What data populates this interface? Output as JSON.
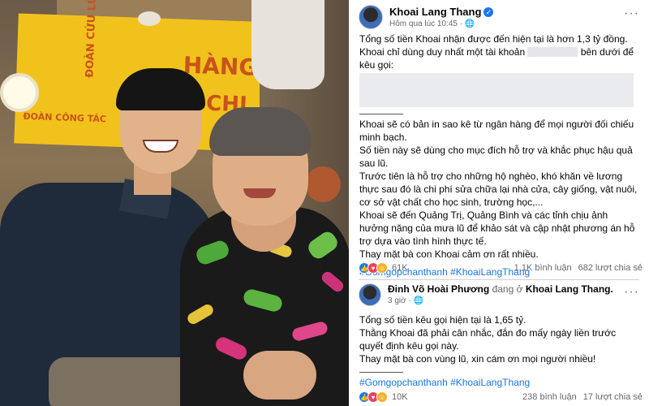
{
  "photo": {
    "banner_lines": [
      "ĐOÀN CỨU LŨ",
      "HÀNG",
      "CHI",
      "ĐOÀN CÔNG TÁC"
    ],
    "alt_icon": "photo-two-people"
  },
  "post": {
    "author": "Khoai Lang Thang",
    "verified_icon": "verified-badge-icon",
    "time": "Hôm qua lúc 10:45",
    "privacy_icon": "globe-icon",
    "menu_icon": "more-dots-icon",
    "paragraphs": [
      "Tổng số tiền Khoai nhận được đến hiện tại là hơn 1,3 tỷ đồng.",
      "Khoai sẽ có bản in sao kê từ ngân hàng để mọi người đối chiếu minh bạch.",
      "Số tiền này sẽ dùng cho mục đích hỗ trợ và khắc phục hậu quả sau lũ.",
      "Trước tiên là hỗ trợ cho những hộ nghèo, khó khăn về lương thực sau đó là chi phí sửa chữa lại nhà cửa, cây giống, vật nuôi, cơ sở vật chất cho học sinh, trường học,...",
      "Khoai sẽ đến Quảng Trị, Quảng Bình và các tỉnh chịu ảnh hưởng nặng của mưa lũ để khảo sát và cập nhật phương án hỗ trợ dựa vào tình hình thực tế.",
      "Thay mặt bà con Khoai cảm ơn rất nhiều."
    ],
    "account_line_before": "Khoai chỉ dùng duy nhất một tài khoản",
    "account_line_after": "bên dưới để kêu gọi:",
    "hashtags": "#Gomgopchanthanh #KhoaiLangThang",
    "reactions": "61K",
    "comments": "1,1K bình luận",
    "shares": "682 lượt chia sẻ"
  },
  "comment": {
    "author": "Đinh Võ Hoài Phương",
    "at_text": "đang ở",
    "place": "Khoai Lang Thang.",
    "time": "3 giờ",
    "paragraphs": [
      "Tổng số tiền kêu gọi hiện tại là 1,65 tỷ.",
      "Thằng Khoai đã phải cân nhắc, đắn đo mấy ngày liền trước quyết định kêu gọi này.",
      "Thay mặt bà con vùng lũ, xin cám ơn mọi người nhiều!"
    ],
    "hashtags": "#Gomgopchanthanh #KhoaiLangThang",
    "reactions": "10K",
    "comments": "238 bình luận",
    "shares": "17 lượt chia sẻ"
  },
  "colors": {
    "link": "#1b74e4",
    "like": "#1877f2",
    "love": "#f33e58",
    "haha": "#f7b125"
  }
}
